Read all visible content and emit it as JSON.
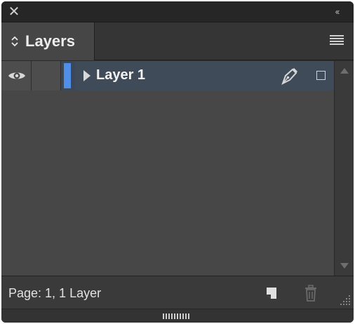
{
  "window": {
    "close_glyph": "✕",
    "collapse_glyph": "‹‹"
  },
  "panel": {
    "tab_label": "Layers"
  },
  "layers": [
    {
      "name": "Layer 1",
      "visible": true,
      "color": "#4f8fe8",
      "expanded": false,
      "selected": true
    }
  ],
  "footer": {
    "status": "Page: 1, 1 Layer"
  },
  "icons": {
    "close": "close-icon",
    "collapse": "double-chevron-left-icon",
    "sort": "up-down-arrows-icon",
    "menu": "hamburger-menu-icon",
    "visibility": "eye-icon",
    "disclosure": "triangle-right-icon",
    "edit": "pen-nib-icon",
    "target": "square-target-icon",
    "new_layer": "new-layer-icon",
    "delete": "trash-icon",
    "resize": "resize-grip-icon"
  },
  "colors": {
    "panel_bg": "#474747",
    "selection": "#404b59",
    "layer_color": "#4f8fe8"
  }
}
